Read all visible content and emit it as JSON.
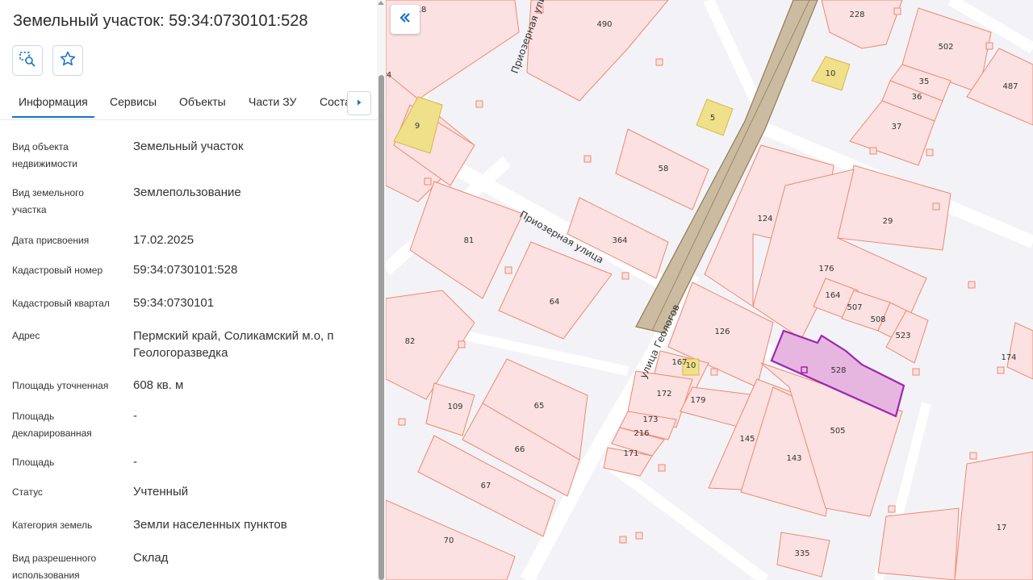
{
  "panel": {
    "title": "Земельный участок: 59:34:0730101:528",
    "tools": [
      {
        "icon": "select-area-icon"
      },
      {
        "icon": "star-icon"
      }
    ],
    "tabs": [
      {
        "label": "Информация",
        "active": true
      },
      {
        "label": "Сервисы",
        "active": false
      },
      {
        "label": "Объекты",
        "active": false
      },
      {
        "label": "Части ЗУ",
        "active": false
      },
      {
        "label": "Соста",
        "active": false
      }
    ],
    "tab_next_icon": "chevron-right-icon",
    "rows": [
      {
        "label": "Вид объекта недвижимости",
        "value": "Земельный участок"
      },
      {
        "label": "Вид земельного участка",
        "value": "Землепользование"
      },
      {
        "label": "Дата присвоения",
        "value": "17.02.2025"
      },
      {
        "label": "Кадастровый номер",
        "value": "59:34:0730101:528"
      },
      {
        "label": "Кадастровый квартал",
        "value": "59:34:0730101"
      },
      {
        "label": "Адрес",
        "value": "Пермский край, Соликамский м.о, п Геологоразведка"
      },
      {
        "label": "Площадь уточненная",
        "value": "608 кв. м"
      },
      {
        "label": "Площадь декларированная",
        "value": "-"
      },
      {
        "label": "Площадь",
        "value": "-"
      },
      {
        "label": "Статус",
        "value": "Учтенный"
      },
      {
        "label": "Категория земель",
        "value": "Земли населенных пунктов"
      },
      {
        "label": "Вид разрешенного использования",
        "value": "Склад"
      }
    ]
  },
  "map": {
    "collapse_icon": "double-chevron-left-icon",
    "colors": {
      "background": "#f3f3f7",
      "parcel_fill": "#fbe1e1",
      "parcel_stroke": "#ef8870",
      "selected_fill": "#e7b6e0",
      "selected_stroke": "#9c27b0",
      "building_fill": "#f0e08a",
      "building_stroke": "#d4b84a",
      "strip_fill": "#cbbba0",
      "strip_stroke": "#8f7c55",
      "road": "#ffffff"
    },
    "streets": [
      "Приозерная улица",
      "Приозерная улица",
      "улица Геологов"
    ],
    "parcel_labels": [
      "490",
      "228",
      "502",
      "35",
      "36",
      "487",
      "37",
      "10",
      "5",
      "9",
      "58",
      "124",
      "29",
      "364",
      "81",
      "176",
      "164",
      "507",
      "508",
      "523",
      "64",
      "126",
      "82",
      "167",
      "528",
      "172",
      "179",
      "174",
      "109",
      "65",
      "173",
      "216",
      "66",
      "171",
      "145",
      "143",
      "505",
      "67",
      "70",
      "17",
      "335",
      "4",
      "18",
      "10"
    ],
    "selected_parcel": "528"
  }
}
